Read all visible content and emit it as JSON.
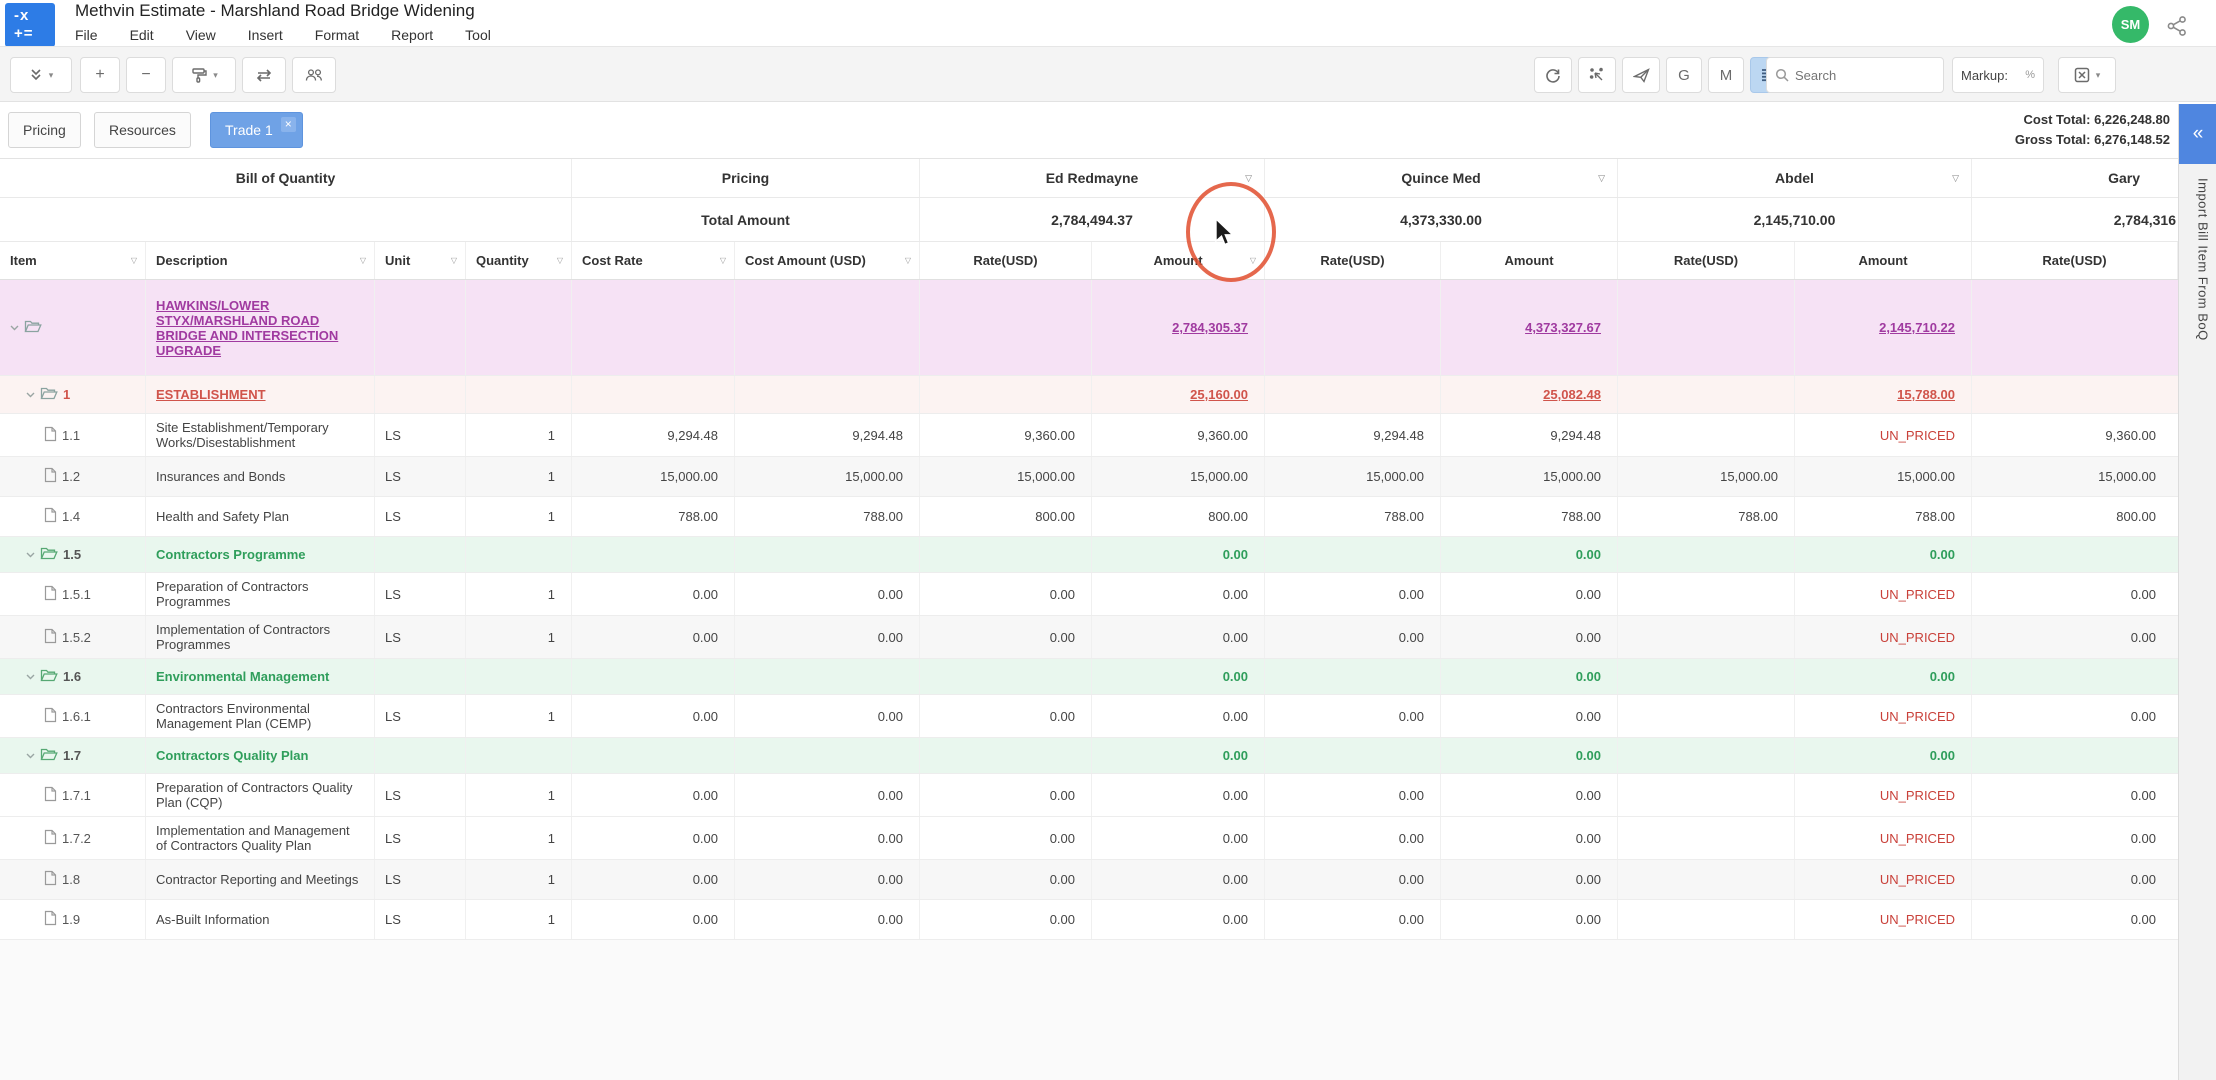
{
  "app": {
    "title": "Methvin Estimate - Marshland Road Bridge Widening",
    "menu": [
      "File",
      "Edit",
      "View",
      "Insert",
      "Format",
      "Report",
      "Tool"
    ],
    "avatar": "SM",
    "logo_line1": "-x",
    "logo_line2": "+="
  },
  "toolbar": {
    "search_placeholder": "Search",
    "markup_label": "Markup:",
    "markup_suffix": "%",
    "left_icons": [
      "collapse-all",
      "add",
      "remove",
      "format-painter",
      "swap",
      "people"
    ],
    "right_icons": [
      "refresh",
      "distribute",
      "send",
      "g-shortcut",
      "m-shortcut",
      "row-density",
      "export-excel"
    ],
    "g_label": "G",
    "m_label": "M"
  },
  "tabs": [
    {
      "label": "Pricing",
      "active": false
    },
    {
      "label": "Resources",
      "active": false
    },
    {
      "label": "Trade 1",
      "active": true,
      "closable": true
    }
  ],
  "totals": {
    "cost_label": "Cost Total:",
    "cost_value": "6,226,248.80",
    "gross_label": "Gross Total:",
    "gross_value": "6,276,148.52"
  },
  "side_panel": {
    "label": "Import Bill Item From BoQ",
    "collapse_icon": "chevrons-left"
  },
  "table": {
    "groups": [
      "Bill of Quantity",
      "Pricing",
      "Ed Redmayne",
      "Quince Med",
      "Abdel",
      "Gary"
    ],
    "total_amount_label": "Total Amount",
    "bidder_totals": {
      "ed": "2,784,494.37",
      "quince": "4,373,330.00",
      "abdel": "2,145,710.00",
      "gary": "2,784,316"
    },
    "columns": [
      "Item",
      "Description",
      "Unit",
      "Quantity",
      "Cost Rate",
      "Cost Amount (USD)",
      "Rate(USD)",
      "Amount",
      "Rate(USD)",
      "Amount",
      "Rate(USD)",
      "Amount",
      "Rate(USD)"
    ],
    "rows": [
      {
        "type": "root",
        "item": "",
        "desc": "HAWKINS/LOWER STYX/MARSHLAND ROAD BRIDGE AND INTERSECTION UPGRADE",
        "unit": "",
        "qty": "",
        "cost_rate": "",
        "cost_amount": "",
        "bids": [
          "",
          "2,784,305.37",
          "",
          "4,373,327.67",
          "",
          "2,145,710.22",
          ""
        ]
      },
      {
        "type": "section",
        "item": "1",
        "desc": "ESTABLISHMENT",
        "unit": "",
        "qty": "",
        "cost_rate": "",
        "cost_amount": "",
        "bids": [
          "",
          "25,160.00",
          "",
          "25,082.48",
          "",
          "15,788.00",
          ""
        ]
      },
      {
        "type": "item",
        "item": "1.1",
        "desc": "Site Establishment/Temporary Works/Disestablishment",
        "unit": "LS",
        "qty": "1",
        "cost_rate": "9,294.48",
        "cost_amount": "9,294.48",
        "bids": [
          "9,360.00",
          "9,360.00",
          "9,294.48",
          "9,294.48",
          "",
          "UN_PRICED",
          "9,360.00"
        ]
      },
      {
        "type": "item",
        "stripe": true,
        "item": "1.2",
        "desc": "Insurances and Bonds",
        "unit": "LS",
        "qty": "1",
        "cost_rate": "15,000.00",
        "cost_amount": "15,000.00",
        "bids": [
          "15,000.00",
          "15,000.00",
          "15,000.00",
          "15,000.00",
          "15,000.00",
          "15,000.00",
          "15,000.00"
        ]
      },
      {
        "type": "item",
        "item": "1.4",
        "desc": "Health and Safety Plan",
        "unit": "LS",
        "qty": "1",
        "cost_rate": "788.00",
        "cost_amount": "788.00",
        "bids": [
          "800.00",
          "800.00",
          "788.00",
          "788.00",
          "788.00",
          "788.00",
          "800.00"
        ]
      },
      {
        "type": "group",
        "item": "1.5",
        "desc": "Contractors Programme",
        "unit": "",
        "qty": "",
        "cost_rate": "",
        "cost_amount": "",
        "bids": [
          "",
          "0.00",
          "",
          "0.00",
          "",
          "0.00",
          ""
        ]
      },
      {
        "type": "item",
        "item": "1.5.1",
        "desc": "Preparation of Contractors Programmes",
        "unit": "LS",
        "qty": "1",
        "cost_rate": "0.00",
        "cost_amount": "0.00",
        "bids": [
          "0.00",
          "0.00",
          "0.00",
          "0.00",
          "",
          "UN_PRICED",
          "0.00"
        ]
      },
      {
        "type": "item",
        "stripe": true,
        "item": "1.5.2",
        "desc": "Implementation of Contractors Programmes",
        "unit": "LS",
        "qty": "1",
        "cost_rate": "0.00",
        "cost_amount": "0.00",
        "bids": [
          "0.00",
          "0.00",
          "0.00",
          "0.00",
          "",
          "UN_PRICED",
          "0.00"
        ]
      },
      {
        "type": "group",
        "item": "1.6",
        "desc": "Environmental Management",
        "unit": "",
        "qty": "",
        "cost_rate": "",
        "cost_amount": "",
        "bids": [
          "",
          "0.00",
          "",
          "0.00",
          "",
          "0.00",
          ""
        ]
      },
      {
        "type": "item",
        "item": "1.6.1",
        "desc": "Contractors Environmental Management Plan (CEMP)",
        "unit": "LS",
        "qty": "1",
        "cost_rate": "0.00",
        "cost_amount": "0.00",
        "bids": [
          "0.00",
          "0.00",
          "0.00",
          "0.00",
          "",
          "UN_PRICED",
          "0.00"
        ]
      },
      {
        "type": "group",
        "item": "1.7",
        "desc": "Contractors Quality Plan",
        "unit": "",
        "qty": "",
        "cost_rate": "",
        "cost_amount": "",
        "bids": [
          "",
          "0.00",
          "",
          "0.00",
          "",
          "0.00",
          ""
        ]
      },
      {
        "type": "item",
        "item": "1.7.1",
        "desc": "Preparation of Contractors Quality Plan (CQP)",
        "unit": "LS",
        "qty": "1",
        "cost_rate": "0.00",
        "cost_amount": "0.00",
        "bids": [
          "0.00",
          "0.00",
          "0.00",
          "0.00",
          "",
          "UN_PRICED",
          "0.00"
        ]
      },
      {
        "type": "item",
        "item": "1.7.2",
        "desc": "Implementation and Management of Contractors Quality Plan",
        "unit": "LS",
        "qty": "1",
        "cost_rate": "0.00",
        "cost_amount": "0.00",
        "bids": [
          "0.00",
          "0.00",
          "0.00",
          "0.00",
          "",
          "UN_PRICED",
          "0.00"
        ]
      },
      {
        "type": "item",
        "stripe": true,
        "item": "1.8",
        "desc": "Contractor Reporting and Meetings",
        "unit": "LS",
        "qty": "1",
        "cost_rate": "0.00",
        "cost_amount": "0.00",
        "bids": [
          "0.00",
          "0.00",
          "0.00",
          "0.00",
          "",
          "UN_PRICED",
          "0.00"
        ]
      },
      {
        "type": "item",
        "item": "1.9",
        "desc": "As-Built Information",
        "unit": "LS",
        "qty": "1",
        "cost_rate": "0.00",
        "cost_amount": "0.00",
        "bids": [
          "0.00",
          "0.00",
          "0.00",
          "0.00",
          "",
          "UN_PRICED",
          "0.00"
        ]
      }
    ]
  }
}
